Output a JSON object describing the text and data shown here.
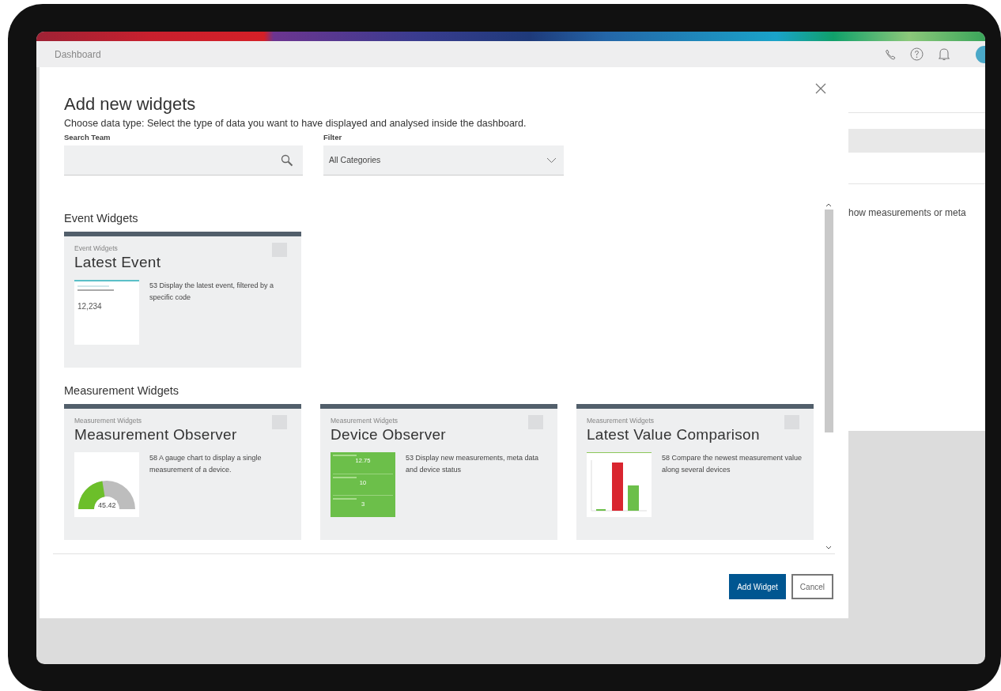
{
  "header": {
    "title": "Dashboard"
  },
  "background": {
    "text": "how measurements or meta"
  },
  "modal": {
    "title": "Add new widgets",
    "subtitle": "Choose data type: Select the type of data you want to have displayed and analysed inside the dashboard.",
    "search": {
      "label": "Search Team"
    },
    "filter": {
      "label": "Filter",
      "value": "All Categories"
    },
    "sections": [
      {
        "title": "Event Widgets",
        "widgets": [
          {
            "category": "Event Widgets",
            "name": "Latest Event",
            "description": "53 Display the latest event, filtered by a specific code",
            "checked": false,
            "preview": {
              "kind": "event",
              "value": "12,234"
            }
          }
        ]
      },
      {
        "title": "Measurement Widgets",
        "widgets": [
          {
            "category": "Measurement Widgets",
            "name": "Measurement Observer",
            "description": "58 A gauge chart to display a single measurement of a device.",
            "checked": false,
            "preview": {
              "kind": "gauge",
              "value": "45.42",
              "level": 0.45
            }
          },
          {
            "category": "Measurement Widgets",
            "name": "Device Observer",
            "description": "53 Display new measurements, meta data and device status",
            "checked": false,
            "preview": {
              "kind": "device",
              "values": [
                "12.75",
                "10",
                "3"
              ]
            }
          },
          {
            "category": "Measurement Widgets",
            "name": "Latest Value Comparison",
            "description": "58 Compare the newest measurement value along several devices",
            "checked": false,
            "preview": {
              "kind": "bars"
            }
          }
        ]
      }
    ],
    "buttons": [
      {
        "label": "Add Widget",
        "kind": "primary"
      },
      {
        "label": "Cancel",
        "kind": "secondary"
      }
    ]
  }
}
